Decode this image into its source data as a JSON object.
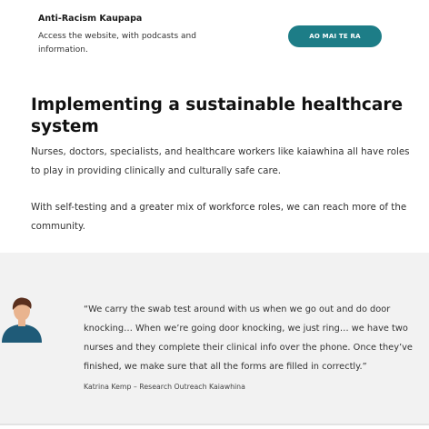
{
  "resource": {
    "title": "Anti-Racism Kaupapa",
    "description": "Access the website, with podcasts and information.",
    "button_label": "AO MAI TE RA"
  },
  "section": {
    "heading": "Implementing a sustainable healthcare system",
    "paragraphs": [
      "Nurses, doctors, specialists, and healthcare workers like kaiawhina all have roles to play in providing clinically and culturally safe care.",
      "With self-testing and a greater mix of workforce roles, we can reach more of the community."
    ]
  },
  "testimonial": {
    "avatar_icon": "person-avatar-icon",
    "quote": "“We carry the swab test around with us when we go out and do door knocking… When we’re going door knocking, we just ring… we have two nurses and they complete their clinical info over the phone. Once they’ve finished, we make sure that all the forms are filled in correctly.”",
    "attribution": "Katrina Kemp – Research Outreach Kaiawhina"
  },
  "colors": {
    "button": "#1d7d87",
    "quote_background": "#f2f2f2",
    "avatar_shirt": "#1f5b78",
    "avatar_hair": "#5a2f1d",
    "avatar_skin": "#e9b48f"
  }
}
